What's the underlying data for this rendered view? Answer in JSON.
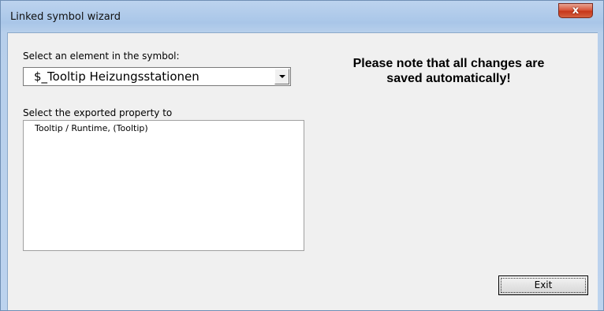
{
  "window": {
    "title": "Linked symbol wizard",
    "close_glyph": "x"
  },
  "left_panel": {
    "element_label": "Select an element in the symbol:",
    "element_selected": "$_Tooltip Heizungsstationen",
    "property_label": "Select the exported property to",
    "properties": [
      "Tooltip / Runtime, (Tooltip)"
    ]
  },
  "notice": {
    "text": "Please note that all changes are saved automatically!"
  },
  "footer": {
    "exit_label": "Exit"
  }
}
